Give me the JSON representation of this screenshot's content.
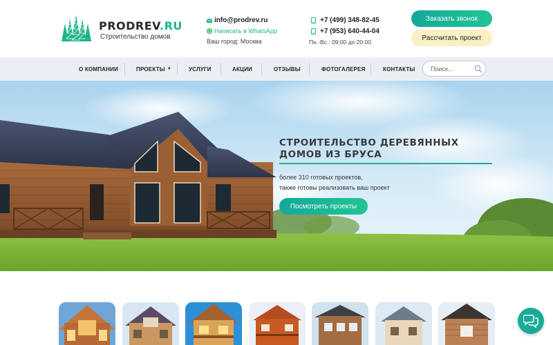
{
  "header": {
    "logo": {
      "name": "PRODREV",
      "tld": ".RU",
      "subtitle": "Строительство домов"
    },
    "email": "info@prodrev.ru",
    "whatsapp": "Написать в WhatsApp",
    "city": "Ваш город: Москва",
    "phones": [
      "+7 (499) 348-82-45",
      "+7 (953) 640-44-04"
    ],
    "hours": "Пн.-Вс.: 09:00 до 20:00",
    "call_button": "Заказать звонок",
    "calc_button": "Рассчитать проект",
    "colors": {
      "accent": "#1fb48a",
      "accent_dark": "#13a998",
      "calc_bg": "#fbefc4"
    }
  },
  "nav": {
    "items": [
      {
        "label": "О КОМПАНИИ"
      },
      {
        "label": "ПРОЕКТЫ",
        "dropdown": true
      },
      {
        "label": "УСЛУГИ"
      },
      {
        "label": "АКЦИИ"
      },
      {
        "label": "ОТЗЫВЫ"
      },
      {
        "label": "ФОТОГАЛЕРЕЯ"
      },
      {
        "label": "КОНТАКТЫ"
      }
    ],
    "search_placeholder": "Поиск..."
  },
  "hero": {
    "title_lines": [
      "СТРОИТЕЛЬСТВО ДЕРЕВЯННЫХ",
      "ДОМОВ ИЗ БРУСА"
    ],
    "text_lines": [
      "более 310 готовых проектов,",
      "также готовы реализовать ваш проект"
    ],
    "button": "Посмотреть проекты"
  },
  "icons": {
    "email": "envelope-icon",
    "whatsapp": "whatsapp-icon",
    "phone": "phone-icon",
    "search": "search-icon",
    "chat": "chat-bubbles-icon"
  }
}
